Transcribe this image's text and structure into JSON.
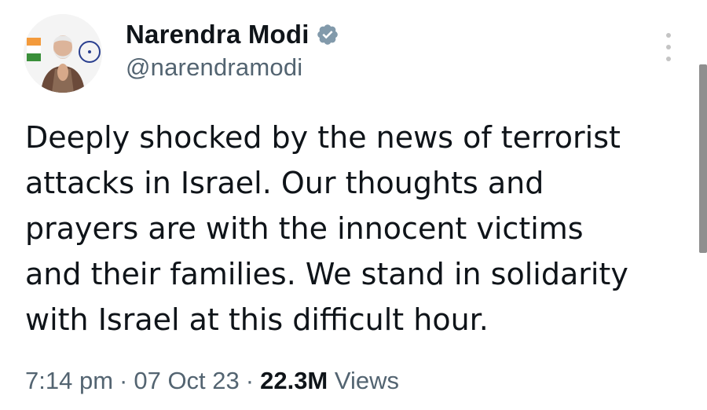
{
  "tweet": {
    "author": {
      "display_name": "Narendra Modi",
      "handle": "@narendramodi",
      "verified": true,
      "avatar_icon": "profile-photo"
    },
    "text_lines": [
      "Deeply shocked by the news of terrorist",
      "attacks in Israel. Our thoughts and",
      "prayers are with the innocent victims",
      "and their families. We stand in solidarity",
      "with Israel at this difficult hour."
    ],
    "meta": {
      "time": "7:14 pm",
      "separator": "·",
      "date": "07 Oct 23",
      "views_count": "22.3M",
      "views_label": "Views"
    }
  },
  "colors": {
    "text_primary": "#0f1419",
    "text_secondary": "#536471",
    "verified_badge": "#829aab",
    "more_dots": "#c4c4c4",
    "scrollbar": "#8f8f8f"
  },
  "icons": {
    "verified": "verified-badge-icon",
    "more": "more-options-icon"
  }
}
